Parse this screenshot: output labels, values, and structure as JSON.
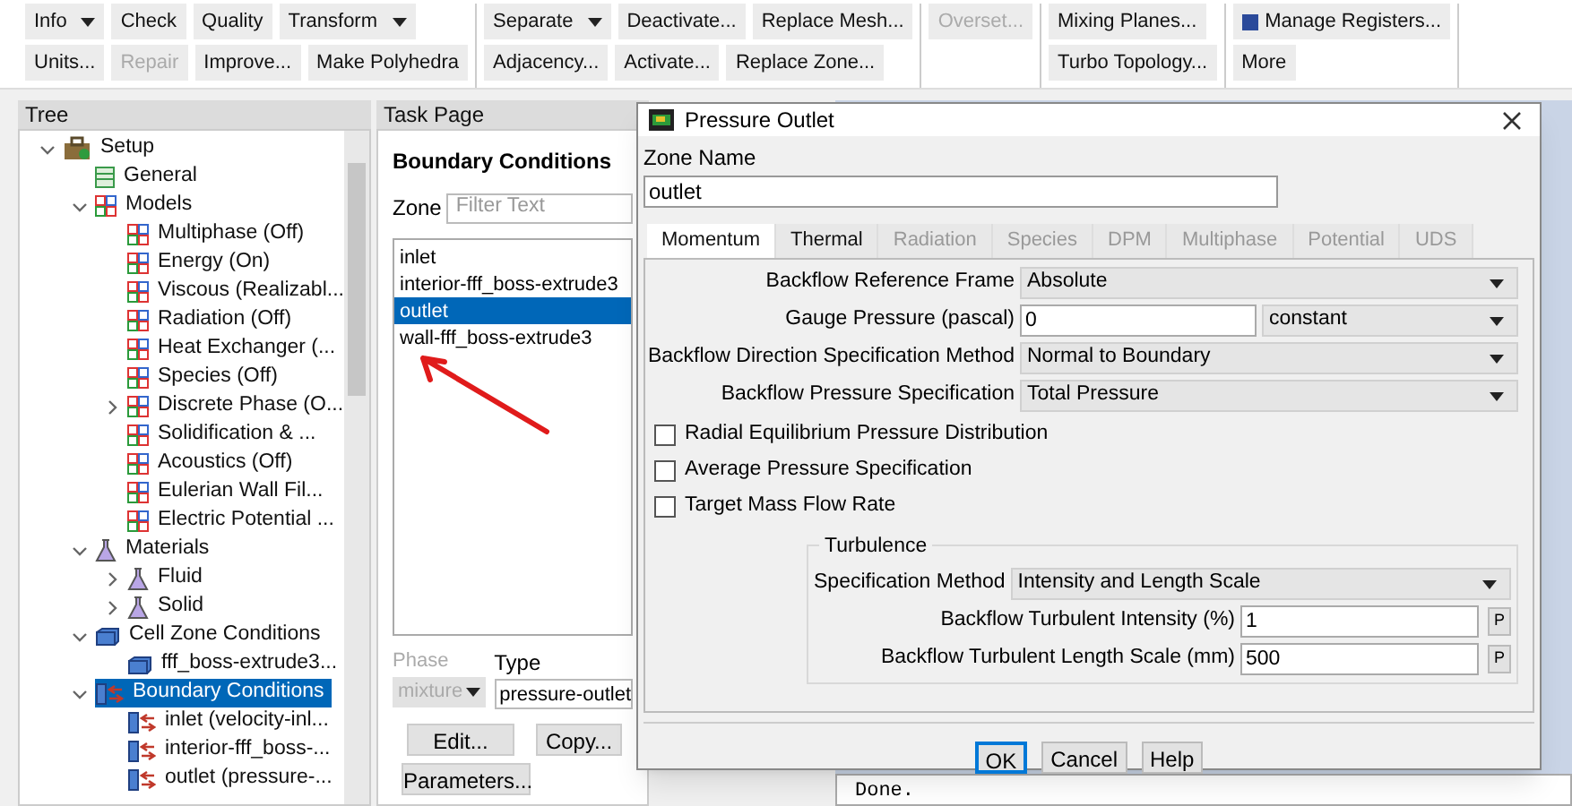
{
  "ribbon": {
    "groups": [
      {
        "top": [
          {
            "label": "Info",
            "dropdown": true,
            "disabled": false
          },
          {
            "label": "Check",
            "dropdown": false,
            "disabled": false
          },
          {
            "label": "Quality",
            "dropdown": false,
            "disabled": false
          },
          {
            "label": "Transform",
            "dropdown": true,
            "disabled": false
          }
        ],
        "bottom": [
          {
            "label": "Units...",
            "dropdown": false,
            "disabled": false
          },
          {
            "label": "Repair",
            "dropdown": false,
            "disabled": true
          },
          {
            "label": "Improve...",
            "dropdown": false,
            "disabled": false
          },
          {
            "label": "Make Polyhedra",
            "dropdown": false,
            "disabled": false
          }
        ]
      },
      {
        "top": [
          {
            "label": "Separate",
            "dropdown": true,
            "disabled": false
          },
          {
            "label": "Deactivate...",
            "dropdown": false,
            "disabled": false
          },
          {
            "label": "Replace Mesh...",
            "dropdown": false,
            "disabled": false
          }
        ],
        "bottom": [
          {
            "label": "Adjacency...",
            "dropdown": false,
            "disabled": false
          },
          {
            "label": "Activate...",
            "dropdown": false,
            "disabled": false
          },
          {
            "label": "Replace Zone...",
            "dropdown": false,
            "disabled": false
          }
        ]
      },
      {
        "top": [
          {
            "label": "Overset...",
            "dropdown": false,
            "disabled": true
          }
        ]
      },
      {
        "top": [
          {
            "label": "Mixing Planes...",
            "dropdown": false,
            "disabled": false
          }
        ],
        "bottom": [
          {
            "label": "Turbo Topology...",
            "dropdown": false,
            "disabled": false
          }
        ]
      },
      {
        "top": [
          {
            "label": "Manage Registers...",
            "dropdown": false,
            "disabled": false,
            "icon": true
          }
        ],
        "bottom": [
          {
            "label": "More",
            "dropdown": false,
            "disabled": false
          }
        ]
      }
    ]
  },
  "tree": {
    "title": "Tree",
    "items": [
      {
        "label": "Setup",
        "kind": "setup",
        "expanded": true,
        "selected": false,
        "children": [
          {
            "label": "General",
            "kind": "general",
            "selected": false
          },
          {
            "label": "Models",
            "kind": "model",
            "expanded": true,
            "selected": false,
            "children": [
              {
                "label": "Multiphase (Off)",
                "kind": "model",
                "selected": false
              },
              {
                "label": "Energy (On)",
                "kind": "model",
                "selected": false
              },
              {
                "label": "Viscous (Realizabl...",
                "kind": "model",
                "selected": false
              },
              {
                "label": "Radiation (Off)",
                "kind": "model",
                "selected": false
              },
              {
                "label": "Heat Exchanger (...",
                "kind": "model",
                "selected": false
              },
              {
                "label": "Species (Off)",
                "kind": "model",
                "selected": false
              },
              {
                "label": "Discrete Phase (O...",
                "kind": "model",
                "expanded": false,
                "selected": false
              },
              {
                "label": "Solidification & ...",
                "kind": "model",
                "selected": false
              },
              {
                "label": "Acoustics (Off)",
                "kind": "model",
                "selected": false
              },
              {
                "label": "Eulerian Wall Fil...",
                "kind": "model",
                "selected": false
              },
              {
                "label": "Electric Potential ...",
                "kind": "model",
                "selected": false
              }
            ]
          },
          {
            "label": "Materials",
            "kind": "material",
            "expanded": true,
            "selected": false,
            "children": [
              {
                "label": "Fluid",
                "kind": "material",
                "expanded": false,
                "selected": false
              },
              {
                "label": "Solid",
                "kind": "material",
                "expanded": false,
                "selected": false
              }
            ]
          },
          {
            "label": "Cell Zone Conditions",
            "kind": "cell-zone",
            "expanded": true,
            "selected": false,
            "children": [
              {
                "label": "fff_boss-extrude3...",
                "kind": "cell-zone",
                "selected": false
              }
            ]
          },
          {
            "label": "Boundary Conditions",
            "kind": "boundary",
            "expanded": true,
            "selected": true,
            "children": [
              {
                "label": "inlet (velocity-inl...",
                "kind": "boundary",
                "selected": false
              },
              {
                "label": "interior-fff_boss-...",
                "kind": "boundary",
                "selected": false
              },
              {
                "label": "outlet (pressure-...",
                "kind": "boundary",
                "selected": false
              }
            ]
          }
        ]
      }
    ]
  },
  "task_page": {
    "header": "Task Page",
    "title": "Boundary Conditions",
    "zone_label": "Zone",
    "filter": {
      "placeholder": "Filter Text"
    },
    "zones": [
      {
        "label": "inlet",
        "selected": false
      },
      {
        "label": "interior-fff_boss-extrude3",
        "selected": false
      },
      {
        "label": "outlet",
        "selected": true
      },
      {
        "label": "wall-fff_boss-extrude3",
        "selected": false
      }
    ],
    "phase": {
      "label": "Phase",
      "value": "mixture",
      "disabled": true
    },
    "type": {
      "label": "Type",
      "value": "pressure-outlet"
    },
    "buttons": [
      "Edit...",
      "Copy...",
      "Parameters..."
    ]
  },
  "console": {
    "text": "Done."
  },
  "dialog": {
    "title": "Pressure Outlet",
    "zone_name_label": "Zone Name",
    "zone_name": "outlet",
    "tabs": [
      {
        "label": "Momentum",
        "selected": true,
        "disabled": false
      },
      {
        "label": "Thermal",
        "selected": false,
        "disabled": false
      },
      {
        "label": "Radiation",
        "selected": false,
        "disabled": true
      },
      {
        "label": "Species",
        "selected": false,
        "disabled": true
      },
      {
        "label": "DPM",
        "selected": false,
        "disabled": true
      },
      {
        "label": "Multiphase",
        "selected": false,
        "disabled": true
      },
      {
        "label": "Potential",
        "selected": false,
        "disabled": true
      },
      {
        "label": "UDS",
        "selected": false,
        "disabled": true
      }
    ],
    "fields": [
      {
        "kind": "select",
        "label": "Backflow Reference Frame",
        "value": "Absolute"
      },
      {
        "kind": "input-select",
        "label": "Gauge Pressure (pascal)",
        "value": "0",
        "option": "constant"
      },
      {
        "kind": "select",
        "label": "Backflow Direction Specification Method",
        "value": "Normal to Boundary"
      },
      {
        "kind": "select",
        "label": "Backflow Pressure Specification",
        "value": "Total Pressure"
      }
    ],
    "checkboxes": [
      {
        "label": "Radial Equilibrium Pressure Distribution",
        "checked": false
      },
      {
        "label": "Average Pressure Specification",
        "checked": false
      },
      {
        "label": "Target Mass Flow Rate",
        "checked": false
      }
    ],
    "turbulence": {
      "title": "Turbulence",
      "fields": [
        {
          "kind": "select",
          "label": "Specification Method",
          "value": "Intensity and Length Scale"
        },
        {
          "kind": "param",
          "label": "Backflow Turbulent Intensity (%)",
          "value": "1",
          "button": "P"
        },
        {
          "kind": "param",
          "label": "Backflow Turbulent Length Scale (mm)",
          "value": "500",
          "button": "P"
        }
      ]
    },
    "buttons": [
      {
        "label": "OK",
        "focused": true
      },
      {
        "label": "Cancel",
        "focused": false
      },
      {
        "label": "Help",
        "focused": false
      }
    ]
  }
}
